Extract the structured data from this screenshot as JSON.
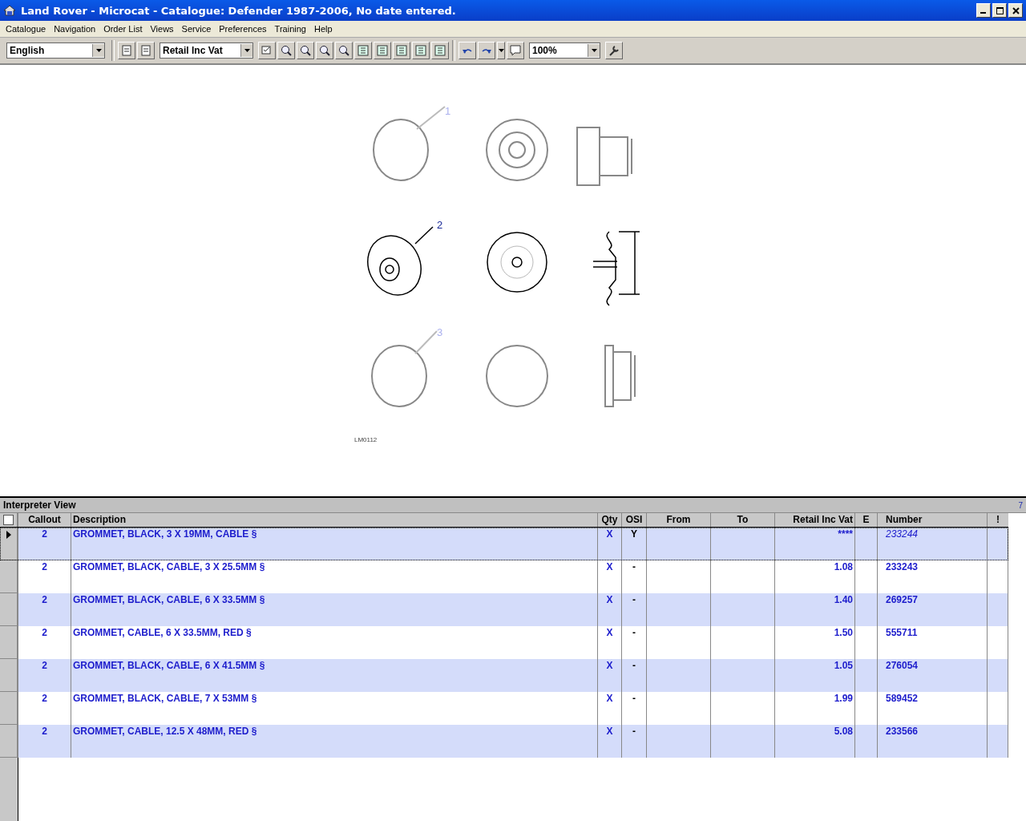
{
  "window": {
    "title": "Land Rover - Microcat - Catalogue: Defender 1987-2006, No date entered."
  },
  "menu": [
    "Catalogue",
    "Navigation",
    "Order List",
    "Views",
    "Service",
    "Preferences",
    "Training",
    "Help"
  ],
  "toolbar": {
    "language": "English",
    "price_type": "Retail Inc Vat",
    "zoom": "100%"
  },
  "illustration": {
    "callouts": [
      {
        "label": "1",
        "faded": true
      },
      {
        "label": "2",
        "faded": false
      },
      {
        "label": "3",
        "faded": true
      }
    ],
    "code": "LM0112"
  },
  "interpreter": {
    "title": "Interpreter View",
    "count": "7",
    "all_checked": false,
    "columns": [
      "Callout",
      "Description",
      "Qty",
      "OSI",
      "From",
      "To",
      "Retail Inc Vat",
      "E",
      "Number",
      "!"
    ],
    "rows": [
      {
        "callout": "2",
        "description": "GROMMET, BLACK, 3 X 19MM, CABLE §",
        "qty": "X",
        "osi": "Y",
        "price": "****",
        "number": "233244",
        "selected": true,
        "number_italic": true
      },
      {
        "callout": "2",
        "description": "GROMMET, BLACK, CABLE, 3 X 25.5MM §",
        "qty": "X",
        "osi": "-",
        "price": "1.08",
        "number": "233243",
        "selected": false,
        "number_italic": false
      },
      {
        "callout": "2",
        "description": "GROMMET, BLACK, CABLE, 6 X 33.5MM §",
        "qty": "X",
        "osi": "-",
        "price": "1.40",
        "number": "269257",
        "selected": false,
        "number_italic": false
      },
      {
        "callout": "2",
        "description": "GROMMET, CABLE, 6 X 33.5MM, RED §",
        "qty": "X",
        "osi": "-",
        "price": "1.50",
        "number": "555711",
        "selected": false,
        "number_italic": false
      },
      {
        "callout": "2",
        "description": "GROMMET, BLACK, CABLE, 6 X 41.5MM §",
        "qty": "X",
        "osi": "-",
        "price": "1.05",
        "number": "276054",
        "selected": false,
        "number_italic": false
      },
      {
        "callout": "2",
        "description": "GROMMET, BLACK, CABLE, 7 X 53MM §",
        "qty": "X",
        "osi": "-",
        "price": "1.99",
        "number": "589452",
        "selected": false,
        "number_italic": false
      },
      {
        "callout": "2",
        "description": "GROMMET, CABLE, 12.5 X 48MM, RED §",
        "qty": "X",
        "osi": "-",
        "price": "5.08",
        "number": "233566",
        "selected": false,
        "number_italic": false
      }
    ]
  }
}
